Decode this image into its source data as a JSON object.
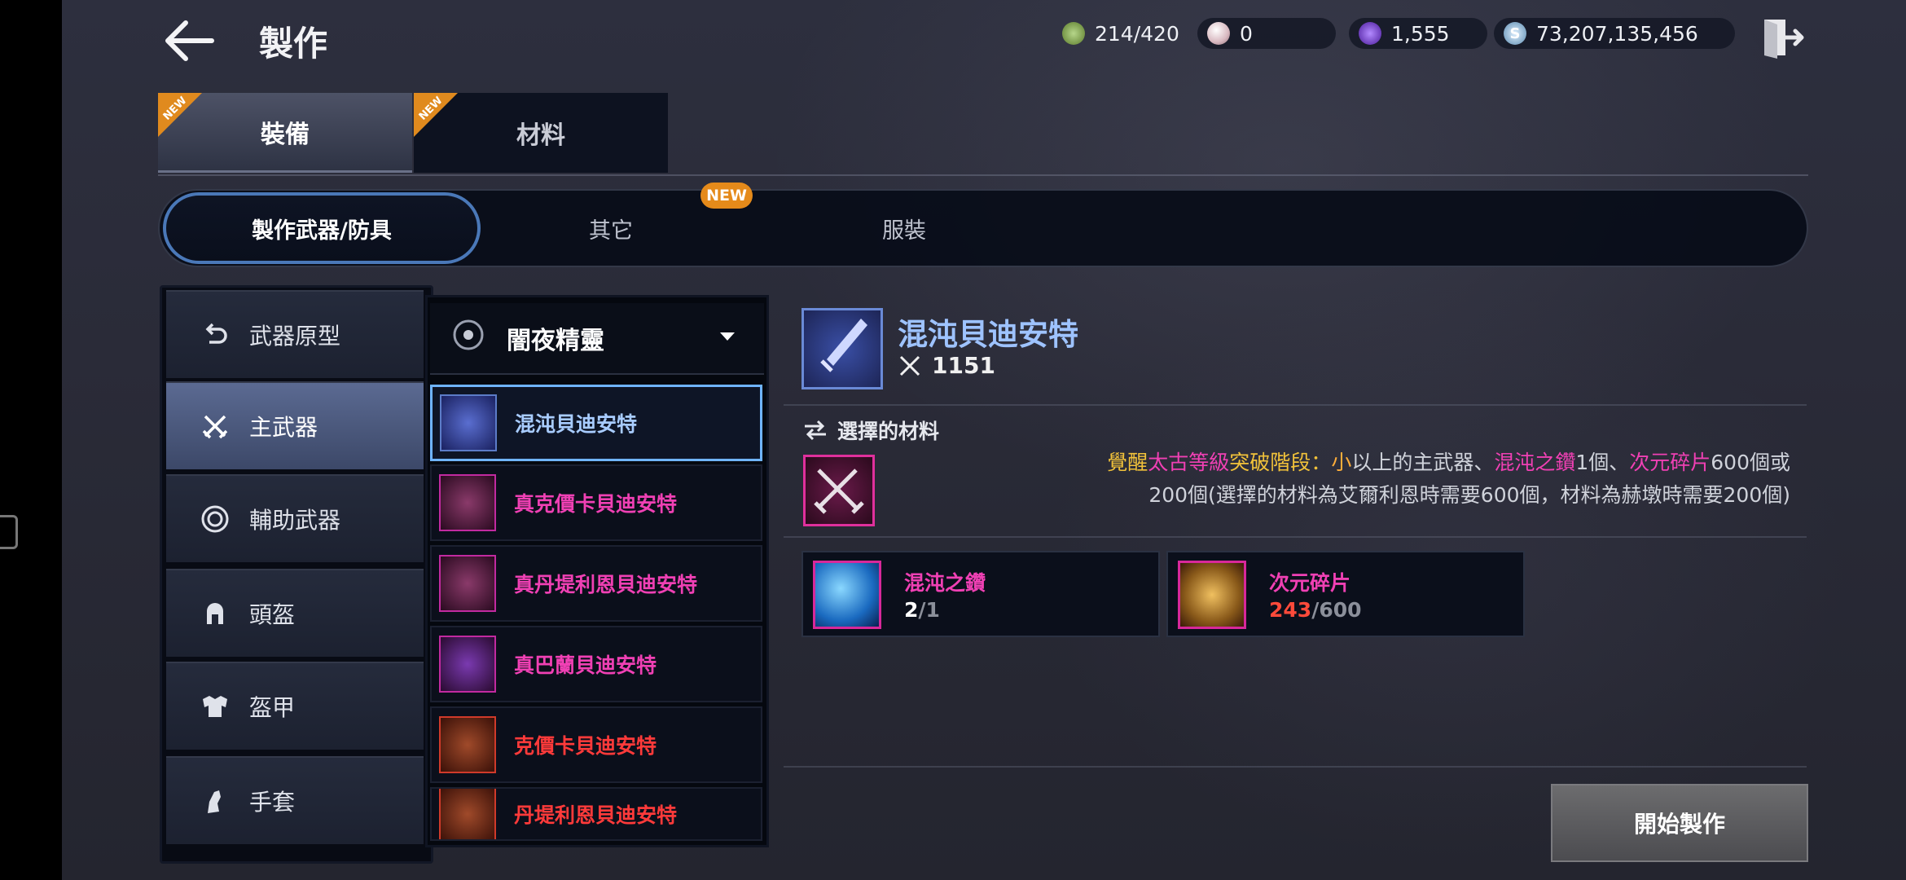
{
  "header": {
    "title": "製作",
    "resources": [
      {
        "id": "stamina",
        "value": "214/420",
        "color": "#7fa84a"
      },
      {
        "id": "pearl",
        "value": "0",
        "color": "#e8d0d4"
      },
      {
        "id": "crystal",
        "value": "1,555",
        "color": "#7a3ad6"
      },
      {
        "id": "silver",
        "value": "73,207,135,456",
        "color": "#8fc0e8"
      }
    ],
    "exit_icon": "exit-door-icon"
  },
  "main_tabs": [
    {
      "label": "裝備",
      "badge": "NEW",
      "active": true
    },
    {
      "label": "材料",
      "badge": "NEW",
      "active": false
    }
  ],
  "sub_tabs": [
    {
      "label": "製作武器/防具",
      "active": true
    },
    {
      "label": "其它",
      "badge": "NEW"
    },
    {
      "label": "服裝"
    }
  ],
  "categories": [
    {
      "label": "武器原型",
      "icon": "undo-arrow-icon"
    },
    {
      "label": "主武器",
      "icon": "crossed-swords-icon",
      "active": true
    },
    {
      "label": "輔助武器",
      "icon": "target-ring-icon"
    },
    {
      "label": "頭盔",
      "icon": "helmet-icon"
    },
    {
      "label": "盔甲",
      "icon": "armor-icon"
    },
    {
      "label": "手套",
      "icon": "glove-icon"
    }
  ],
  "class_dropdown": {
    "selected": "闇夜精靈"
  },
  "weapons": [
    {
      "name": "混沌貝迪安特",
      "color": "#a8ccff",
      "selected": true
    },
    {
      "name": "真克價卡貝迪安特",
      "color": "#f040b4"
    },
    {
      "name": "真丹堤利恩貝迪安特",
      "color": "#f040b4"
    },
    {
      "name": "真巴蘭貝迪安特",
      "color": "#f040b4"
    },
    {
      "name": "克價卡貝迪安特",
      "color": "#ff3a3a"
    },
    {
      "name": "丹堤利恩貝迪安特",
      "color": "#ff3a3a"
    }
  ],
  "detail": {
    "name": "混沌貝迪安特",
    "power": "1151",
    "selected_materials_label": "選擇的材料",
    "description": {
      "p1": "覺醒",
      "p2": "太古等級",
      "p3": "突破階段",
      "p4": "：",
      "p5": "小",
      "p6": "以上的主武器、",
      "p7": "混沌之鑽",
      "p8": "1個、",
      "p9": "次元碎片",
      "p10": "600個或",
      "line2": "200個(選擇的材料為艾爾利恩時需要600個，材料為赫墩時需要200個)"
    },
    "materials": [
      {
        "name": "混沌之鑽",
        "have": "2",
        "need": "1"
      },
      {
        "name": "次元碎片",
        "have": "243",
        "need": "600"
      }
    ],
    "start_button": "開始製作"
  }
}
